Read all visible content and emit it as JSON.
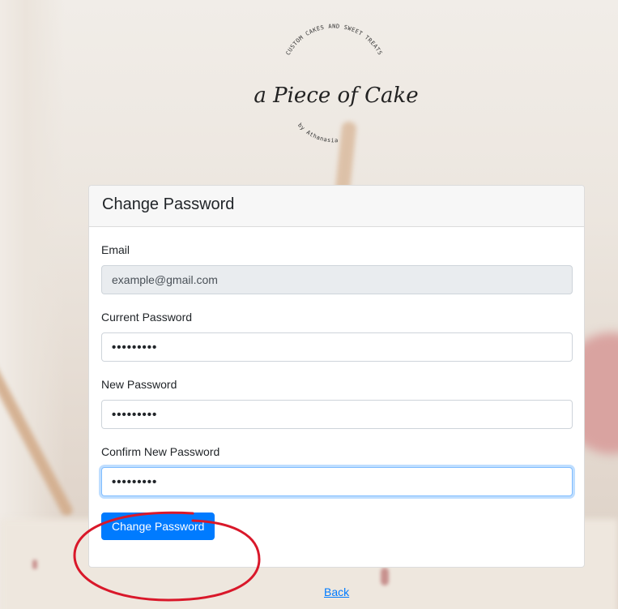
{
  "logo": {
    "arc_text_top": "CUSTOM CAKES AND SWEET TREATS",
    "script_text": "a Piece of Cake",
    "arc_text_bottom": "by Athanasia",
    "icon": "a-piece-of-cake-logo"
  },
  "card": {
    "title": "Change Password"
  },
  "form": {
    "email": {
      "label": "Email",
      "value": "example@gmail.com"
    },
    "current_password": {
      "label": "Current Password",
      "value": "•••••••••"
    },
    "new_password": {
      "label": "New Password",
      "value": "•••••••••"
    },
    "confirm_password": {
      "label": "Confirm New Password",
      "value": "•••••••••"
    },
    "submit_label": "Change Password"
  },
  "footer": {
    "back_label": "Back"
  },
  "colors": {
    "primary": "#007bff",
    "annotation": "#d9182a"
  }
}
